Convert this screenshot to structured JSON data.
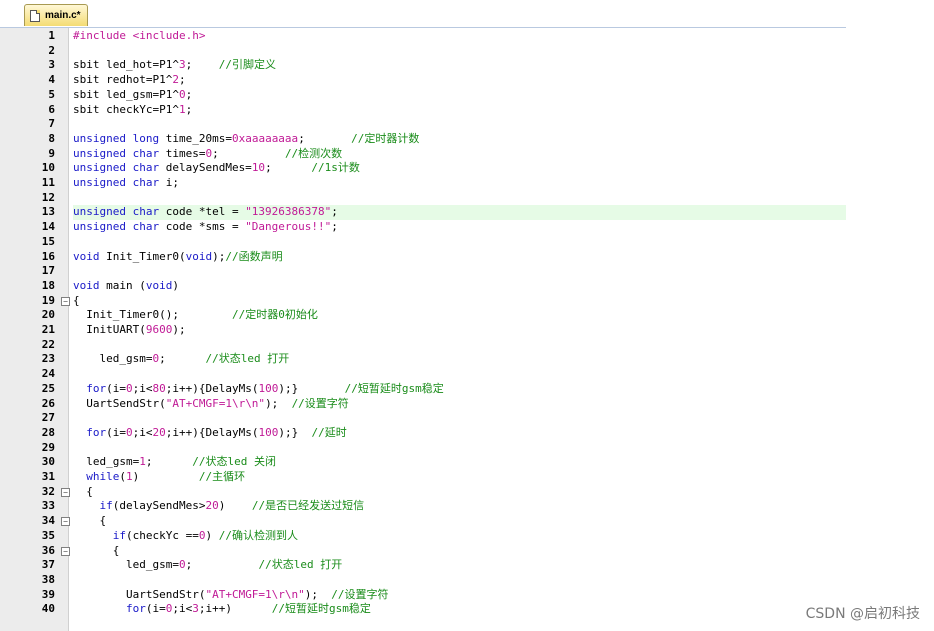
{
  "tab": {
    "label": "main.c*"
  },
  "colors": {
    "keyword": "#1a1ac8",
    "comment": "#1a8c1a",
    "string": "#c01a96",
    "number": "#c01a96",
    "plain": "#000000",
    "highlight": "#e6fbe6"
  },
  "lines": [
    {
      "n": "1",
      "fold": "",
      "hl": false,
      "tokens": [
        {
          "t": "#include <include.h>",
          "c": "string"
        }
      ]
    },
    {
      "n": "2",
      "fold": "",
      "hl": false,
      "tokens": []
    },
    {
      "n": "3",
      "fold": "",
      "hl": false,
      "tokens": [
        {
          "t": "sbit led_hot=P1^",
          "c": "plain"
        },
        {
          "t": "3",
          "c": "number"
        },
        {
          "t": ";    ",
          "c": "plain"
        },
        {
          "t": "//引脚定义",
          "c": "comment"
        }
      ]
    },
    {
      "n": "4",
      "fold": "",
      "hl": false,
      "tokens": [
        {
          "t": "sbit redhot=P1^",
          "c": "plain"
        },
        {
          "t": "2",
          "c": "number"
        },
        {
          "t": ";",
          "c": "plain"
        }
      ]
    },
    {
      "n": "5",
      "fold": "",
      "hl": false,
      "tokens": [
        {
          "t": "sbit led_gsm=P1^",
          "c": "plain"
        },
        {
          "t": "0",
          "c": "number"
        },
        {
          "t": ";",
          "c": "plain"
        }
      ]
    },
    {
      "n": "6",
      "fold": "",
      "hl": false,
      "tokens": [
        {
          "t": "sbit checkYc=P1^",
          "c": "plain"
        },
        {
          "t": "1",
          "c": "number"
        },
        {
          "t": ";",
          "c": "plain"
        }
      ]
    },
    {
      "n": "7",
      "fold": "",
      "hl": false,
      "tokens": []
    },
    {
      "n": "8",
      "fold": "",
      "hl": false,
      "tokens": [
        {
          "t": "unsigned long",
          "c": "keyword"
        },
        {
          "t": " time_20ms=",
          "c": "plain"
        },
        {
          "t": "0xaaaaaaaa",
          "c": "number"
        },
        {
          "t": ";       ",
          "c": "plain"
        },
        {
          "t": "//定时器计数",
          "c": "comment"
        }
      ]
    },
    {
      "n": "9",
      "fold": "",
      "hl": false,
      "tokens": [
        {
          "t": "unsigned char",
          "c": "keyword"
        },
        {
          "t": " times=",
          "c": "plain"
        },
        {
          "t": "0",
          "c": "number"
        },
        {
          "t": ";          ",
          "c": "plain"
        },
        {
          "t": "//检测次数",
          "c": "comment"
        }
      ]
    },
    {
      "n": "10",
      "fold": "",
      "hl": false,
      "tokens": [
        {
          "t": "unsigned char",
          "c": "keyword"
        },
        {
          "t": " delaySendMes=",
          "c": "plain"
        },
        {
          "t": "10",
          "c": "number"
        },
        {
          "t": ";      ",
          "c": "plain"
        },
        {
          "t": "//1s计数",
          "c": "comment"
        }
      ]
    },
    {
      "n": "11",
      "fold": "",
      "hl": false,
      "tokens": [
        {
          "t": "unsigned char",
          "c": "keyword"
        },
        {
          "t": " i;",
          "c": "plain"
        }
      ]
    },
    {
      "n": "12",
      "fold": "",
      "hl": false,
      "tokens": []
    },
    {
      "n": "13",
      "fold": "",
      "hl": true,
      "tokens": [
        {
          "t": "unsigned char",
          "c": "keyword"
        },
        {
          "t": " code *tel = ",
          "c": "plain"
        },
        {
          "t": "\"13926386378\"",
          "c": "string"
        },
        {
          "t": ";",
          "c": "plain"
        }
      ]
    },
    {
      "n": "14",
      "fold": "",
      "hl": false,
      "tokens": [
        {
          "t": "unsigned char",
          "c": "keyword"
        },
        {
          "t": " code *sms = ",
          "c": "plain"
        },
        {
          "t": "\"Dangerous!!\"",
          "c": "string"
        },
        {
          "t": ";",
          "c": "plain"
        }
      ]
    },
    {
      "n": "15",
      "fold": "",
      "hl": false,
      "tokens": []
    },
    {
      "n": "16",
      "fold": "",
      "hl": false,
      "tokens": [
        {
          "t": "void",
          "c": "keyword"
        },
        {
          "t": " Init_Timer0(",
          "c": "plain"
        },
        {
          "t": "void",
          "c": "keyword"
        },
        {
          "t": ");",
          "c": "plain"
        },
        {
          "t": "//函数声明",
          "c": "comment"
        }
      ]
    },
    {
      "n": "17",
      "fold": "",
      "hl": false,
      "tokens": []
    },
    {
      "n": "18",
      "fold": "",
      "hl": false,
      "tokens": [
        {
          "t": "void",
          "c": "keyword"
        },
        {
          "t": " main (",
          "c": "plain"
        },
        {
          "t": "void",
          "c": "keyword"
        },
        {
          "t": ")",
          "c": "plain"
        }
      ]
    },
    {
      "n": "19",
      "fold": "−",
      "hl": false,
      "tokens": [
        {
          "t": "{",
          "c": "plain"
        }
      ]
    },
    {
      "n": "20",
      "fold": "",
      "hl": false,
      "tokens": [
        {
          "t": "  Init_Timer0();        ",
          "c": "plain"
        },
        {
          "t": "//定时器0初始化",
          "c": "comment"
        }
      ]
    },
    {
      "n": "21",
      "fold": "",
      "hl": false,
      "tokens": [
        {
          "t": "  InitUART(",
          "c": "plain"
        },
        {
          "t": "9600",
          "c": "number"
        },
        {
          "t": ");",
          "c": "plain"
        }
      ]
    },
    {
      "n": "22",
      "fold": "",
      "hl": false,
      "tokens": []
    },
    {
      "n": "23",
      "fold": "",
      "hl": false,
      "tokens": [
        {
          "t": "    led_gsm=",
          "c": "plain"
        },
        {
          "t": "0",
          "c": "number"
        },
        {
          "t": ";      ",
          "c": "plain"
        },
        {
          "t": "//状态led 打开",
          "c": "comment"
        }
      ]
    },
    {
      "n": "24",
      "fold": "",
      "hl": false,
      "tokens": []
    },
    {
      "n": "25",
      "fold": "",
      "hl": false,
      "tokens": [
        {
          "t": "  ",
          "c": "plain"
        },
        {
          "t": "for",
          "c": "keyword"
        },
        {
          "t": "(i=",
          "c": "plain"
        },
        {
          "t": "0",
          "c": "number"
        },
        {
          "t": ";i<",
          "c": "plain"
        },
        {
          "t": "80",
          "c": "number"
        },
        {
          "t": ";i++){DelayMs(",
          "c": "plain"
        },
        {
          "t": "100",
          "c": "number"
        },
        {
          "t": ");}       ",
          "c": "plain"
        },
        {
          "t": "//短暂延时gsm稳定",
          "c": "comment"
        }
      ]
    },
    {
      "n": "26",
      "fold": "",
      "hl": false,
      "tokens": [
        {
          "t": "  UartSendStr(",
          "c": "plain"
        },
        {
          "t": "\"AT+CMGF=1\\r\\n\"",
          "c": "string"
        },
        {
          "t": ");  ",
          "c": "plain"
        },
        {
          "t": "//设置字符",
          "c": "comment"
        }
      ]
    },
    {
      "n": "27",
      "fold": "",
      "hl": false,
      "tokens": []
    },
    {
      "n": "28",
      "fold": "",
      "hl": false,
      "tokens": [
        {
          "t": "  ",
          "c": "plain"
        },
        {
          "t": "for",
          "c": "keyword"
        },
        {
          "t": "(i=",
          "c": "plain"
        },
        {
          "t": "0",
          "c": "number"
        },
        {
          "t": ";i<",
          "c": "plain"
        },
        {
          "t": "20",
          "c": "number"
        },
        {
          "t": ";i++){DelayMs(",
          "c": "plain"
        },
        {
          "t": "100",
          "c": "number"
        },
        {
          "t": ");}  ",
          "c": "plain"
        },
        {
          "t": "//延时",
          "c": "comment"
        }
      ]
    },
    {
      "n": "29",
      "fold": "",
      "hl": false,
      "tokens": []
    },
    {
      "n": "30",
      "fold": "",
      "hl": false,
      "tokens": [
        {
          "t": "  led_gsm=",
          "c": "plain"
        },
        {
          "t": "1",
          "c": "number"
        },
        {
          "t": ";      ",
          "c": "plain"
        },
        {
          "t": "//状态led 关闭",
          "c": "comment"
        }
      ]
    },
    {
      "n": "31",
      "fold": "",
      "hl": false,
      "tokens": [
        {
          "t": "  ",
          "c": "plain"
        },
        {
          "t": "while",
          "c": "keyword"
        },
        {
          "t": "(",
          "c": "plain"
        },
        {
          "t": "1",
          "c": "number"
        },
        {
          "t": ")         ",
          "c": "plain"
        },
        {
          "t": "//主循环",
          "c": "comment"
        }
      ]
    },
    {
      "n": "32",
      "fold": "−",
      "hl": false,
      "tokens": [
        {
          "t": "  {",
          "c": "plain"
        }
      ]
    },
    {
      "n": "33",
      "fold": "",
      "hl": false,
      "tokens": [
        {
          "t": "    ",
          "c": "plain"
        },
        {
          "t": "if",
          "c": "keyword"
        },
        {
          "t": "(delaySendMes>",
          "c": "plain"
        },
        {
          "t": "20",
          "c": "number"
        },
        {
          "t": ")    ",
          "c": "plain"
        },
        {
          "t": "//是否已经发送过短信",
          "c": "comment"
        }
      ]
    },
    {
      "n": "34",
      "fold": "−",
      "hl": false,
      "tokens": [
        {
          "t": "    {",
          "c": "plain"
        }
      ]
    },
    {
      "n": "35",
      "fold": "",
      "hl": false,
      "tokens": [
        {
          "t": "      ",
          "c": "plain"
        },
        {
          "t": "if",
          "c": "keyword"
        },
        {
          "t": "(checkYc ==",
          "c": "plain"
        },
        {
          "t": "0",
          "c": "number"
        },
        {
          "t": ") ",
          "c": "plain"
        },
        {
          "t": "//确认检测到人",
          "c": "comment"
        }
      ]
    },
    {
      "n": "36",
      "fold": "−",
      "hl": false,
      "tokens": [
        {
          "t": "      {",
          "c": "plain"
        }
      ]
    },
    {
      "n": "37",
      "fold": "",
      "hl": false,
      "tokens": [
        {
          "t": "        led_gsm=",
          "c": "plain"
        },
        {
          "t": "0",
          "c": "number"
        },
        {
          "t": ";          ",
          "c": "plain"
        },
        {
          "t": "//状态led 打开",
          "c": "comment"
        }
      ]
    },
    {
      "n": "38",
      "fold": "",
      "hl": false,
      "tokens": []
    },
    {
      "n": "39",
      "fold": "",
      "hl": false,
      "tokens": [
        {
          "t": "        UartSendStr(",
          "c": "plain"
        },
        {
          "t": "\"AT+CMGF=1\\r\\n\"",
          "c": "string"
        },
        {
          "t": ");  ",
          "c": "plain"
        },
        {
          "t": "//设置字符",
          "c": "comment"
        }
      ]
    },
    {
      "n": "40",
      "fold": "",
      "hl": false,
      "tokens": [
        {
          "t": "        ",
          "c": "plain"
        },
        {
          "t": "for",
          "c": "keyword"
        },
        {
          "t": "(i=",
          "c": "plain"
        },
        {
          "t": "0",
          "c": "number"
        },
        {
          "t": ";i<",
          "c": "plain"
        },
        {
          "t": "3",
          "c": "number"
        },
        {
          "t": ";i++)      ",
          "c": "plain"
        },
        {
          "t": "//短暂延时gsm稳定",
          "c": "comment"
        }
      ]
    }
  ],
  "watermark": "CSDN @启初科技"
}
